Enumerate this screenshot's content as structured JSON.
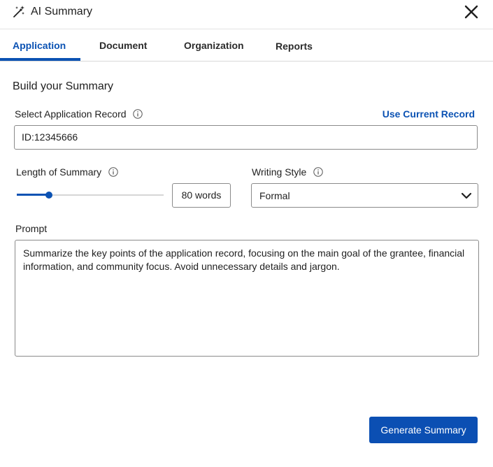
{
  "header": {
    "title": "AI Summary",
    "title_icon": "magic-wand-icon",
    "close_icon": "close-icon"
  },
  "tabs": [
    {
      "label": "Application",
      "active": true
    },
    {
      "label": "Document",
      "active": false
    },
    {
      "label": "Organization",
      "active": false
    },
    {
      "label": "Reports",
      "active": false
    }
  ],
  "form": {
    "section_title": "Build your Summary",
    "record_label": "Select Application Record",
    "use_current_link": "Use Current Record",
    "record_value": "ID:12345666",
    "length_label": "Length of Summary",
    "length_slider_fraction": 0.22,
    "length_value": "80 words",
    "style_label": "Writing Style",
    "style_value": "Formal",
    "prompt_label": "Prompt",
    "prompt_value": "Summarize the key points of the application record, focusing on the main goal of the grantee, financial information, and community focus. Avoid unnecessary details and jargon.",
    "generate_button": "Generate Summary"
  },
  "colors": {
    "accent": "#0b52b3",
    "button_bg": "#0b4fb3"
  }
}
